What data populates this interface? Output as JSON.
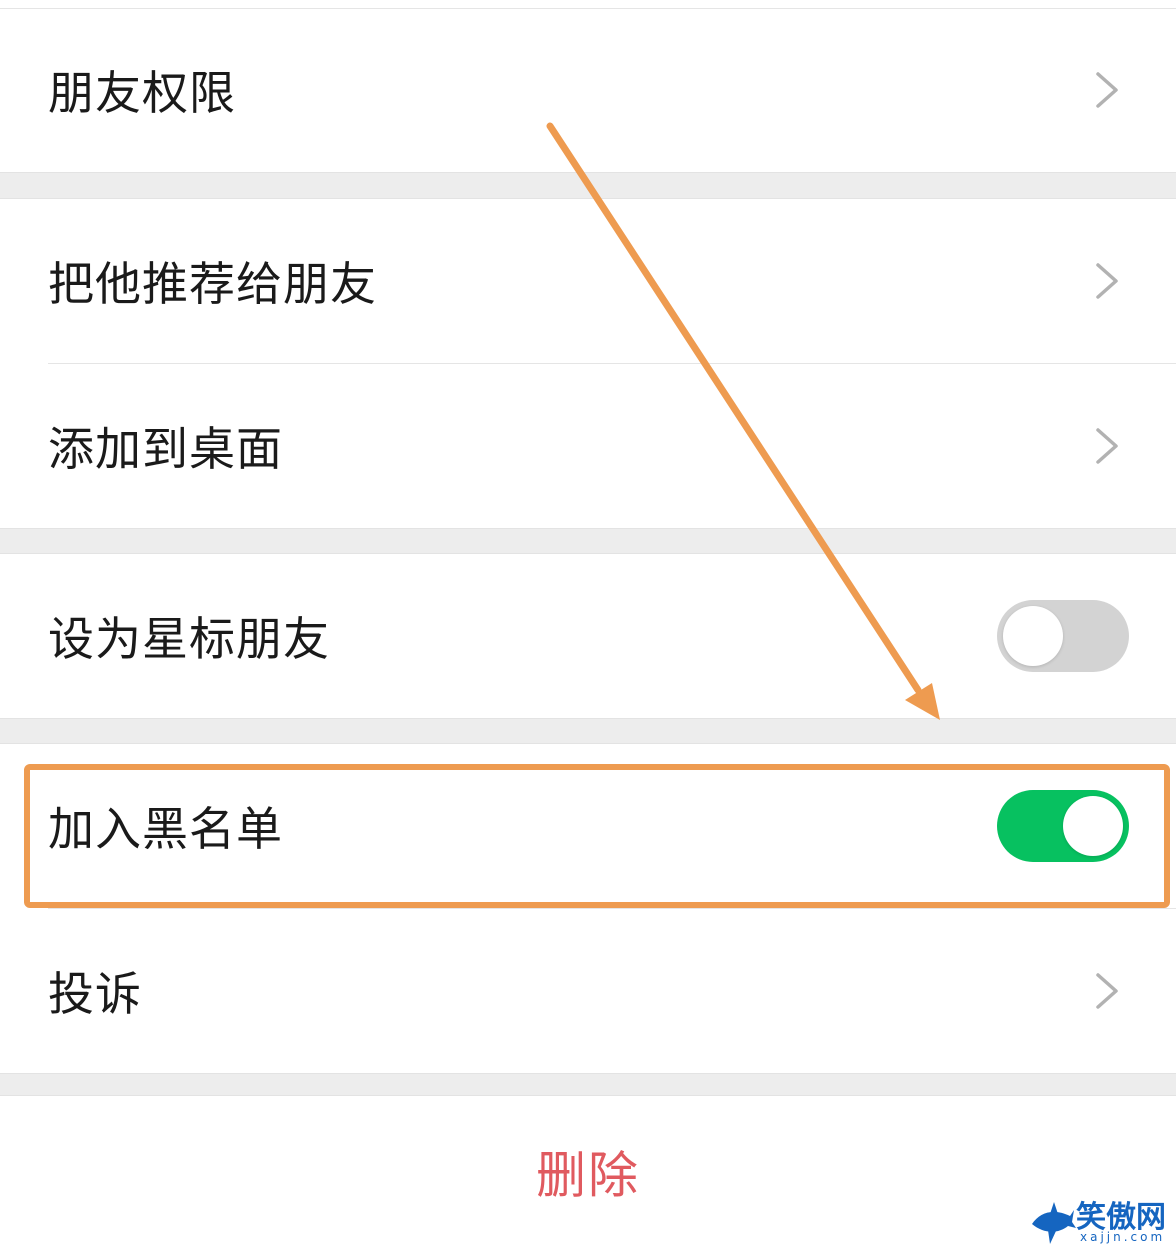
{
  "settings": {
    "friend_permissions": "朋友权限",
    "recommend_to_friend": "把他推荐给朋友",
    "add_to_desktop": "添加到桌面",
    "star_friend": "设为星标朋友",
    "add_to_blacklist": "加入黑名单",
    "complain": "投诉",
    "delete": "删除"
  },
  "toggles": {
    "star_friend_on": false,
    "blacklist_on": true
  },
  "colors": {
    "toggle_on": "#07c160",
    "toggle_off": "#d3d3d3",
    "delete_text": "#e05a5f",
    "annotation": "#ee9b50"
  },
  "icons": {
    "chevron": "chevron-right-icon"
  },
  "watermark": {
    "name": "笑傲网",
    "domain": "xajjn.com"
  }
}
